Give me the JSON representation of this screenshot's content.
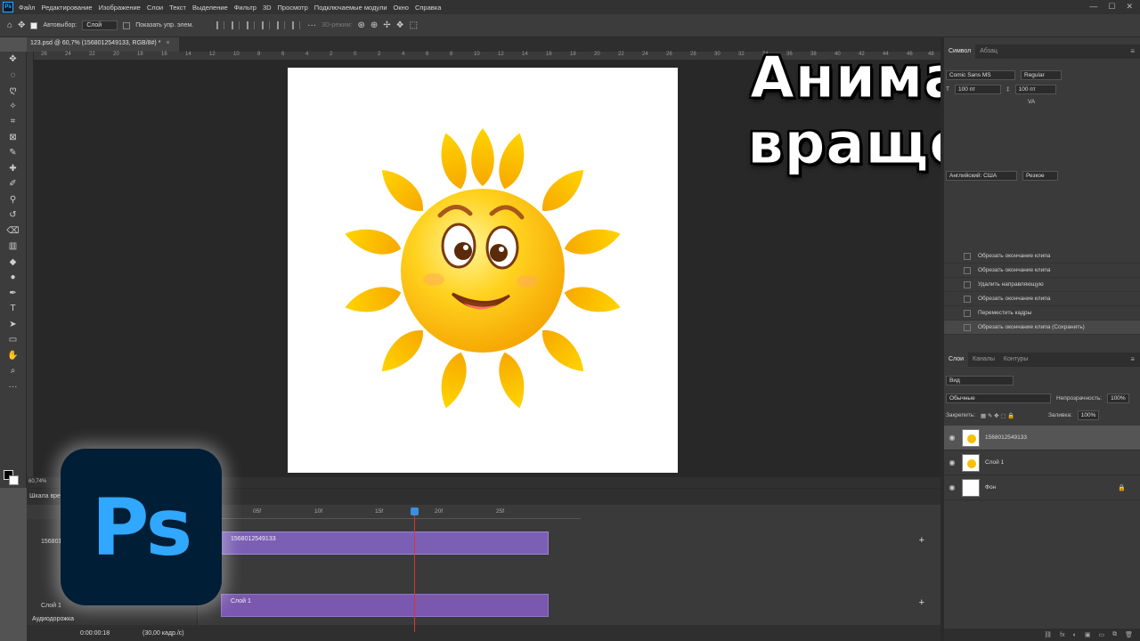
{
  "app": {
    "logo_text": "Ps"
  },
  "menu": [
    "Файл",
    "Редактирование",
    "Изображение",
    "Слои",
    "Текст",
    "Выделение",
    "Фильтр",
    "3D",
    "Просмотр",
    "Подключаемые модули",
    "Окно",
    "Справка"
  ],
  "window_controls": [
    "—",
    "☐",
    "✕"
  ],
  "options_bar": {
    "autoselect_label": "Автовыбор:",
    "autoselect_value": "Слой",
    "show_controls_label": "Показать упр. элем.",
    "mode_3d": "3D-режим:"
  },
  "document_tab": {
    "title": "123.psd @ 60,7% (1568012549133, RGB/8#) *",
    "close": "×"
  },
  "ruler_ticks": [
    "26",
    "24",
    "22",
    "20",
    "18",
    "16",
    "14",
    "12",
    "10",
    "8",
    "6",
    "4",
    "2",
    "0",
    "2",
    "4",
    "6",
    "8",
    "10",
    "12",
    "14",
    "16",
    "18",
    "20",
    "22",
    "24",
    "26",
    "28",
    "30",
    "32",
    "34",
    "36",
    "38",
    "40",
    "42",
    "44",
    "46",
    "48"
  ],
  "status_zoom": "60,74%",
  "overlay": {
    "line1": "Анимация",
    "line2": "вращения"
  },
  "character_panel": {
    "tabs": [
      "Символ",
      "Абзац"
    ],
    "font": "Comic Sans MS",
    "style": "Regular",
    "size": "100 пт",
    "leading": "100 пт",
    "language": "Английский: США",
    "aa": "Резкое",
    "va_label": "VA"
  },
  "history_items": [
    "Обрезать окончание клипа",
    "Обрезать окончание клипа",
    "Удалить направляющую",
    "Обрезать окончание клипа",
    "Переместить кадры",
    "Обрезать окончание клипа (Сохранить)"
  ],
  "layers_panel": {
    "tabs": [
      "Слои",
      "Каналы",
      "Контуры"
    ],
    "filter": "Вид",
    "blend_mode": "Обычные",
    "opacity_label": "Непрозрачность:",
    "opacity_value": "100%",
    "lock_label": "Закрепить:",
    "fill_label": "Заливка:",
    "fill_value": "100%",
    "layers": [
      {
        "name": "1568012549133"
      },
      {
        "name": "Слой 1"
      },
      {
        "name": "Фон"
      }
    ],
    "bottom_icons": [
      "fx",
      "◐",
      "▣",
      "▭",
      "⧉",
      "🗑"
    ]
  },
  "timeline": {
    "title": "Шкала вре",
    "ticks": [
      "05f",
      "10f",
      "15f",
      "20f",
      "25f"
    ],
    "track1_label": "1568012549133",
    "track1_short": "156801",
    "track2_label": "Слой 1",
    "clip1_label": "1568012549133",
    "clip2_label": "Слой 1",
    "audio_label": "Аудиодорожка",
    "timecode": "0:00:00:18",
    "fps": "(30,00 кадр./с)"
  }
}
